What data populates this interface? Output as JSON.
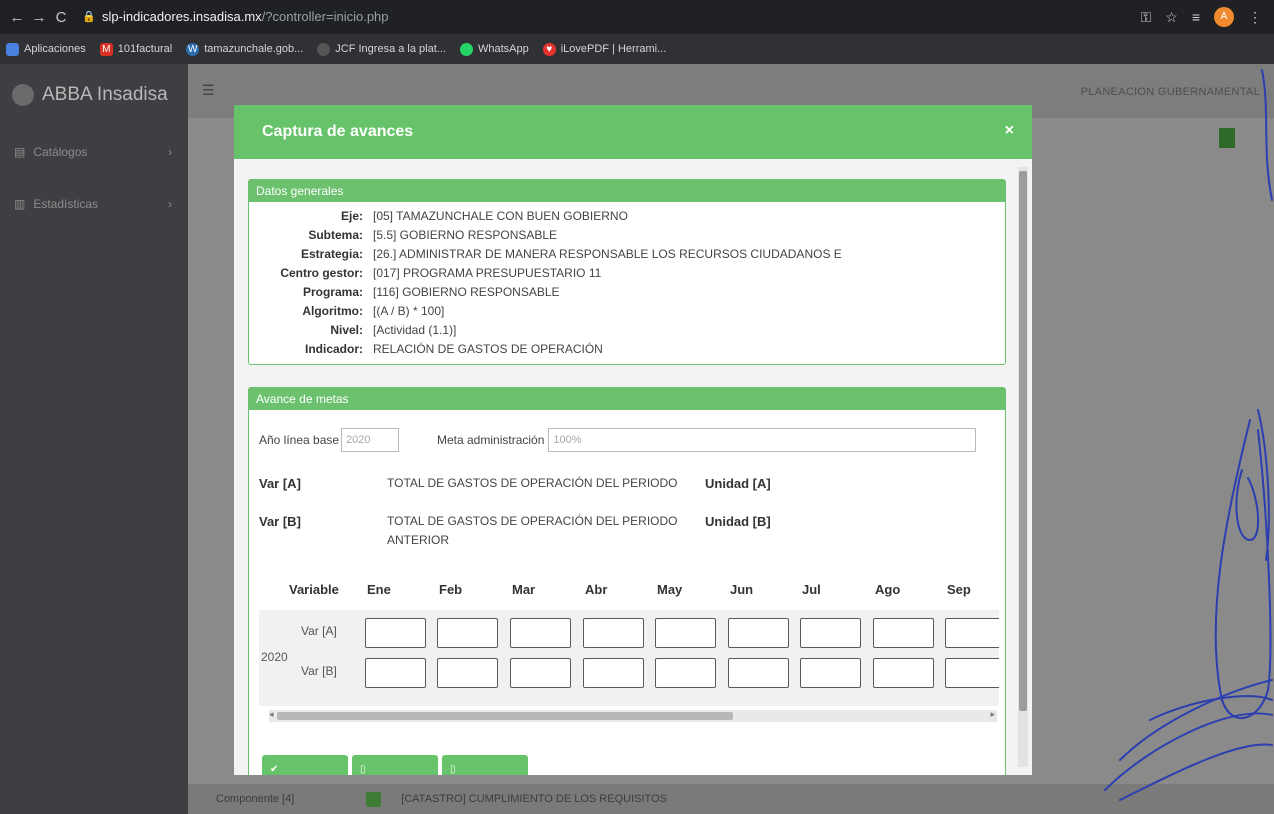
{
  "browser": {
    "url_host": "slp-indicadores.insadisa.mx",
    "url_path": "/?controller=inicio.php",
    "bookmarks": [
      "Aplicaciones",
      "101factural",
      "tamazunchale.gob...",
      "JCF Ingresa a la plat...",
      "WhatsApp",
      "iLovePDF | Herrami..."
    ]
  },
  "app": {
    "brand": "ABBA Insadisa",
    "sidebar": [
      "Catálogos",
      "Estadísticas"
    ],
    "user": "PLANEACION GUBERNAMENTAL",
    "bottom_row": {
      "label": "Componente [4]",
      "text": "[CATASTRO] CUMPLIMIENTO DE LOS REQUISITOS"
    }
  },
  "modal": {
    "title": "Captura de avances",
    "close": "×",
    "datos_generales": {
      "heading": "Datos generales",
      "rows": [
        {
          "label": "Eje:",
          "value": "[05] TAMAZUNCHALE CON BUEN GOBIERNO"
        },
        {
          "label": "Subtema:",
          "value": "[5.5] GOBIERNO RESPONSABLE"
        },
        {
          "label": "Estrategia:",
          "value": "[26.] ADMINISTRAR DE MANERA RESPONSABLE LOS RECURSOS CIUDADANOS E"
        },
        {
          "label": "Centro gestor:",
          "value": "[017] PROGRAMA PRESUPUESTARIO 11"
        },
        {
          "label": "Programa:",
          "value": "[116] GOBIERNO RESPONSABLE"
        },
        {
          "label": "Algoritmo:",
          "value": "[(A / B) * 100]"
        },
        {
          "label": "Nivel:",
          "value": "[Actividad (1.1)]"
        },
        {
          "label": "Indicador:",
          "value": "RELACIÓN DE GASTOS DE OPERACIÓN"
        }
      ]
    },
    "avance": {
      "heading": "Avance de metas",
      "ano_label": "Año línea base",
      "ano_value": "2020",
      "meta_label": "Meta administración",
      "meta_value": "100%",
      "var_a": {
        "label": "Var [A]",
        "desc": "TOTAL DE GASTOS DE OPERACIÓN DEL PERIODO",
        "unit": "Unidad [A]"
      },
      "var_b": {
        "label": "Var [B]",
        "desc1": "TOTAL DE GASTOS DE OPERACIÓN DEL PERIODO",
        "desc2": "ANTERIOR",
        "unit": "Unidad [B]"
      },
      "grid": {
        "variable_header": "Variable",
        "months": [
          "Ene",
          "Feb",
          "Mar",
          "Abr",
          "May",
          "Jun",
          "Jul",
          "Ago",
          "Sep"
        ],
        "year": "2020",
        "rows": [
          "Var [A]",
          "Var [B]"
        ]
      }
    }
  }
}
